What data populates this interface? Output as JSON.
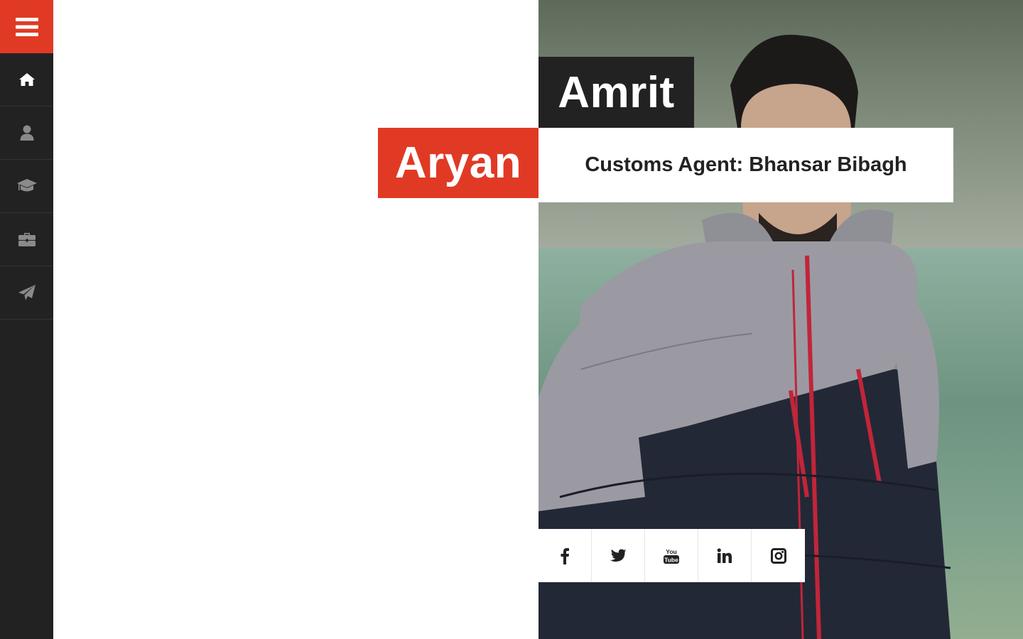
{
  "profile": {
    "first_name": "Amrit",
    "last_name": "Aryan",
    "job_title": "Customs Agent: Bhansar Bibagh"
  },
  "sidebar": {
    "toggle_icon": "bars-icon",
    "items": [
      {
        "icon": "home-icon",
        "active": true
      },
      {
        "icon": "user-icon",
        "active": false
      },
      {
        "icon": "graduation-cap-icon",
        "active": false
      },
      {
        "icon": "briefcase-icon",
        "active": false
      },
      {
        "icon": "paper-plane-icon",
        "active": false
      }
    ]
  },
  "social": [
    {
      "icon": "facebook-icon"
    },
    {
      "icon": "twitter-icon"
    },
    {
      "icon": "youtube-icon",
      "text": "You Tube"
    },
    {
      "icon": "linkedin-icon",
      "text": "in"
    },
    {
      "icon": "instagram-icon"
    }
  ],
  "colors": {
    "accent": "#e03a25",
    "dark": "#222222",
    "active_icon": "#ffffff",
    "inactive_icon": "#8a8a8a"
  }
}
